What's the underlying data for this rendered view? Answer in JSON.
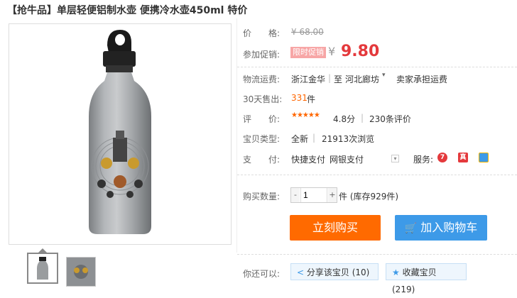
{
  "title": "【抢牛品】单层轻便铝制水壶 便携冷水壶450ml 特价",
  "price": {
    "label": "价　　格:",
    "original": "¥ 68.00",
    "promo_label": "参加促销:",
    "promo_tag": "限时促销",
    "currency": "¥",
    "current": "9.80",
    "accent_color": "#e4393c"
  },
  "shipping": {
    "label": "物流运费:",
    "from": "浙江金华",
    "to_prefix": "至",
    "to": "河北廊坊",
    "fee": "卖家承担运费"
  },
  "sales": {
    "label": "30天售出:",
    "count": "331",
    "unit": "件"
  },
  "rating": {
    "label": "评　　价:",
    "stars": "★★★★★",
    "score": "4.8分",
    "reviews": "230条评价"
  },
  "item_type": {
    "label": "宝贝类型:",
    "condition": "全新",
    "views": "21913次浏览"
  },
  "payment": {
    "label": "支　　付:",
    "methods": [
      "快捷支付",
      "网银支付"
    ],
    "service_label": "服务:",
    "service_icons": [
      {
        "name": "seven-day-return-icon",
        "text": "7",
        "color": "#e4393c"
      },
      {
        "name": "genuine-guarantee-icon",
        "text": "真",
        "color": "#e4393c"
      },
      {
        "name": "consumer-protection-icon",
        "text": "",
        "color": "#3d9ae8"
      }
    ]
  },
  "quantity": {
    "label": "购买数量:",
    "value": "1",
    "minus": "-",
    "plus": "+",
    "stock": "件 (库存929件)"
  },
  "buttons": {
    "buy_now": "立刻购买",
    "add_to_cart": "加入购物车"
  },
  "actions": {
    "label": "你还可以:",
    "share": "分享该宝贝 (10)",
    "favorite": "收藏宝贝 (219)"
  }
}
